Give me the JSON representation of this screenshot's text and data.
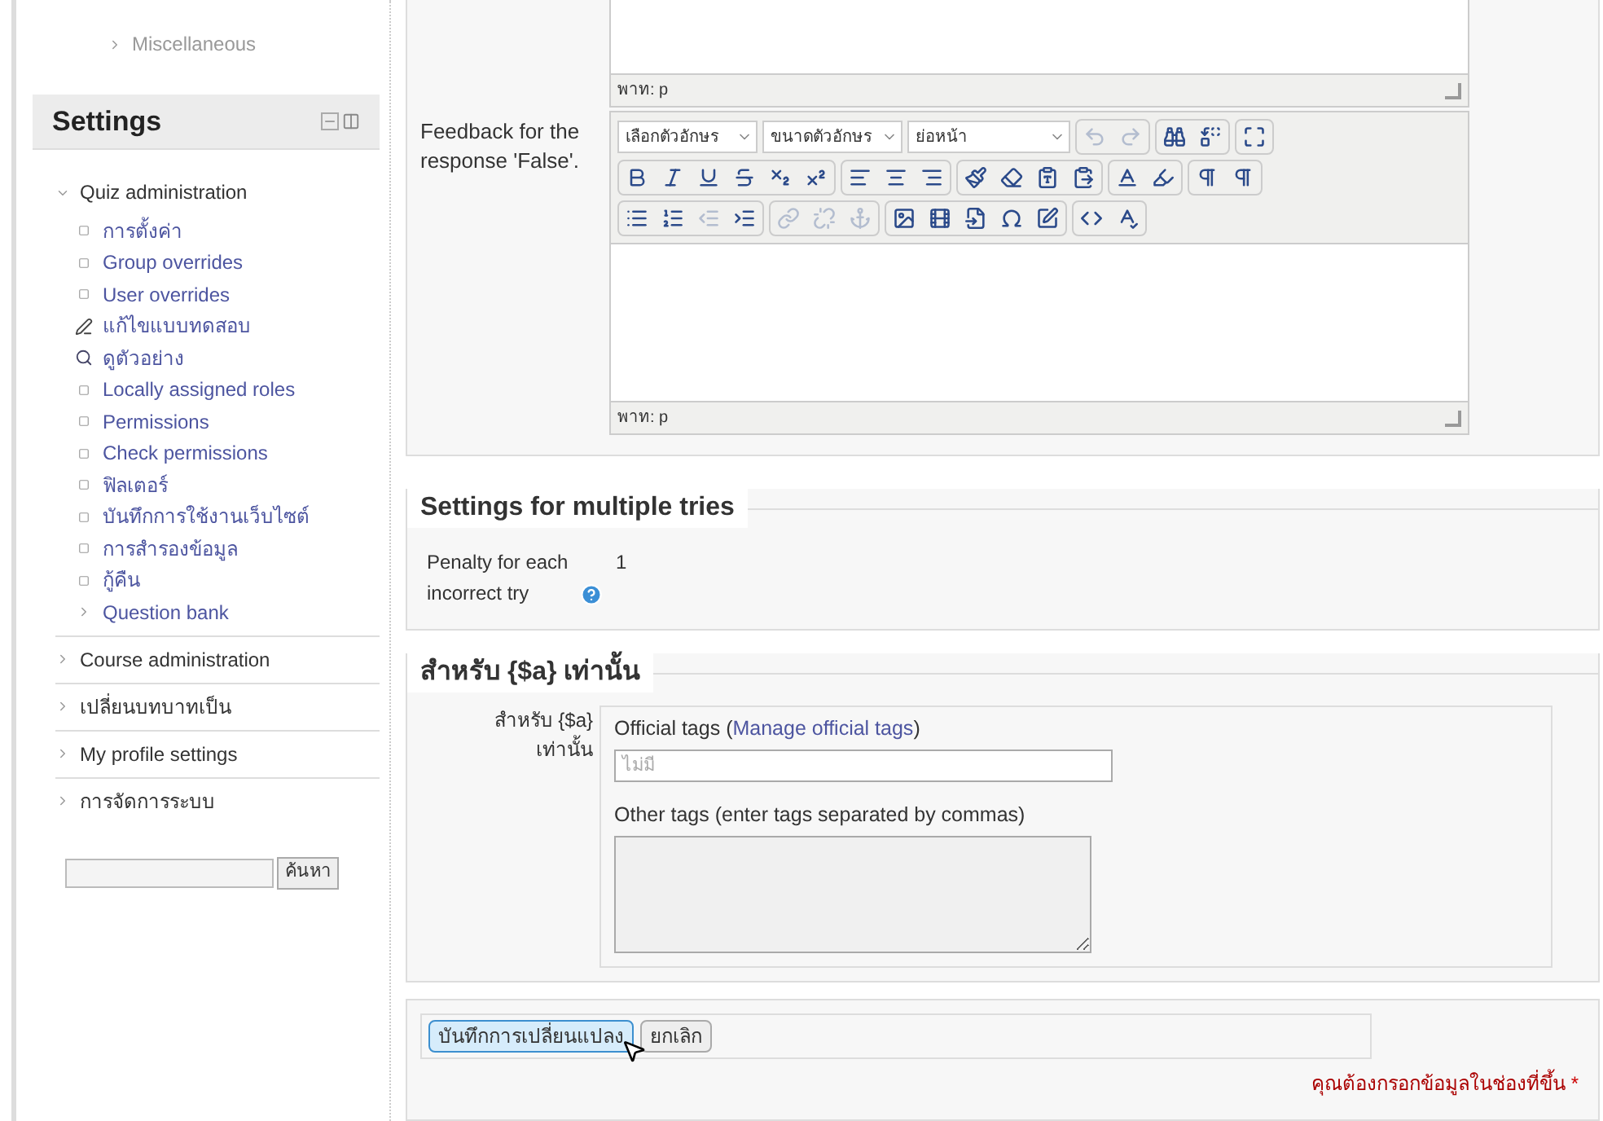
{
  "sidebar": {
    "top_items": [
      {
        "label": "Miscellaneous",
        "kind": "branch"
      }
    ],
    "settings": {
      "title": "Settings",
      "items": [
        {
          "label": "Quiz administration",
          "expanded": true,
          "children": [
            {
              "label": "การตั้งค่า",
              "kind": "leaf"
            },
            {
              "label": "Group overrides",
              "kind": "leaf"
            },
            {
              "label": "User overrides",
              "kind": "leaf"
            },
            {
              "label": "แก้ไขแบบทดสอบ",
              "kind": "edit"
            },
            {
              "label": "ดูตัวอย่าง",
              "kind": "preview"
            },
            {
              "label": "Locally assigned roles",
              "kind": "leaf"
            },
            {
              "label": "Permissions",
              "kind": "leaf"
            },
            {
              "label": "Check permissions",
              "kind": "leaf"
            },
            {
              "label": "ฟิลเตอร์",
              "kind": "leaf"
            },
            {
              "label": "บันทึกการใช้งานเว็บไซต์",
              "kind": "leaf"
            },
            {
              "label": "การสำรองข้อมูล",
              "kind": "leaf"
            },
            {
              "label": "กู้คืน",
              "kind": "leaf"
            },
            {
              "label": "Question bank",
              "kind": "branch"
            }
          ]
        },
        {
          "label": "Course administration",
          "expanded": false
        },
        {
          "label": "เปลี่ยนบทบาทเป็น",
          "expanded": false
        },
        {
          "label": "My profile settings",
          "expanded": false
        },
        {
          "label": "การจัดการระบบ",
          "expanded": false
        }
      ]
    },
    "search_button": "ค้นหา"
  },
  "editors": [
    {
      "path": "พาท: p",
      "cut": true
    },
    {
      "label": "Feedback for the response 'False'.",
      "path": "พาท: p",
      "cut": false,
      "dropdowns": [
        "เลือกตัวอักษร",
        "ขนาดตัวอักษร",
        "ย่อหน้า"
      ],
      "toolbar": [
        [
          [
            {
              "kind": "undo",
              "disabled": true
            },
            {
              "kind": "redo",
              "disabled": true
            }
          ],
          [
            {
              "kind": "find",
              "disabled": false
            },
            {
              "kind": "replace",
              "disabled": false
            }
          ],
          [
            {
              "kind": "fullscreen",
              "disabled": false
            }
          ]
        ],
        [
          [
            {
              "kind": "bold",
              "disabled": false
            },
            {
              "kind": "italic",
              "disabled": false
            },
            {
              "kind": "underline",
              "disabled": false
            },
            {
              "kind": "strike",
              "disabled": false
            },
            {
              "kind": "sub",
              "disabled": false
            },
            {
              "kind": "sup",
              "disabled": false
            }
          ],
          [
            {
              "kind": "alignleft",
              "disabled": false
            },
            {
              "kind": "aligncenter",
              "disabled": false
            },
            {
              "kind": "alignright",
              "disabled": false
            }
          ],
          [
            {
              "kind": "brush",
              "disabled": false
            },
            {
              "kind": "eraser",
              "disabled": false
            },
            {
              "kind": "pastetext",
              "disabled": false
            },
            {
              "kind": "pasteword",
              "disabled": false
            }
          ],
          [
            {
              "kind": "forecolor",
              "disabled": false
            },
            {
              "kind": "highlight",
              "disabled": false
            }
          ],
          [
            {
              "kind": "ltr",
              "disabled": false
            },
            {
              "kind": "rtl",
              "disabled": false
            }
          ]
        ],
        [
          [
            {
              "kind": "bullist",
              "disabled": false
            },
            {
              "kind": "numlist",
              "disabled": false
            },
            {
              "kind": "outdent",
              "disabled": true
            },
            {
              "kind": "indent",
              "disabled": false
            }
          ],
          [
            {
              "kind": "link",
              "disabled": true
            },
            {
              "kind": "unlink",
              "disabled": true
            },
            {
              "kind": "anchor",
              "disabled": true
            }
          ],
          [
            {
              "kind": "image",
              "disabled": false
            },
            {
              "kind": "media",
              "disabled": false
            },
            {
              "kind": "embed",
              "disabled": false
            },
            {
              "kind": "charmap",
              "disabled": false
            },
            {
              "kind": "note",
              "disabled": false
            }
          ],
          [
            {
              "kind": "html",
              "disabled": false
            },
            {
              "kind": "spell",
              "disabled": false
            }
          ]
        ]
      ]
    }
  ],
  "multiple_tries": {
    "legend": "Settings for multiple tries",
    "label": "Penalty for each incorrect try",
    "value": "1"
  },
  "tags": {
    "legend": "สำหรับ {$a} เท่านั้น",
    "label": "สำหรับ {$a} เท่านั้น",
    "official_label": "Official tags",
    "official_link_open": "(",
    "official_link": "Manage official tags",
    "official_link_close": ")",
    "official_placeholder": "ไม่มี",
    "other_label": "Other tags (enter tags separated by commas)"
  },
  "buttons": [
    {
      "label": "บันทึกการเปลี่ยนแปลง",
      "kind": "primary"
    },
    {
      "label": "ยกเลิก",
      "kind": "secondary"
    }
  ],
  "required_note": "คุณต้องกรอกข้อมูลในช่องที่ขึ้น",
  "required_mark": "*"
}
